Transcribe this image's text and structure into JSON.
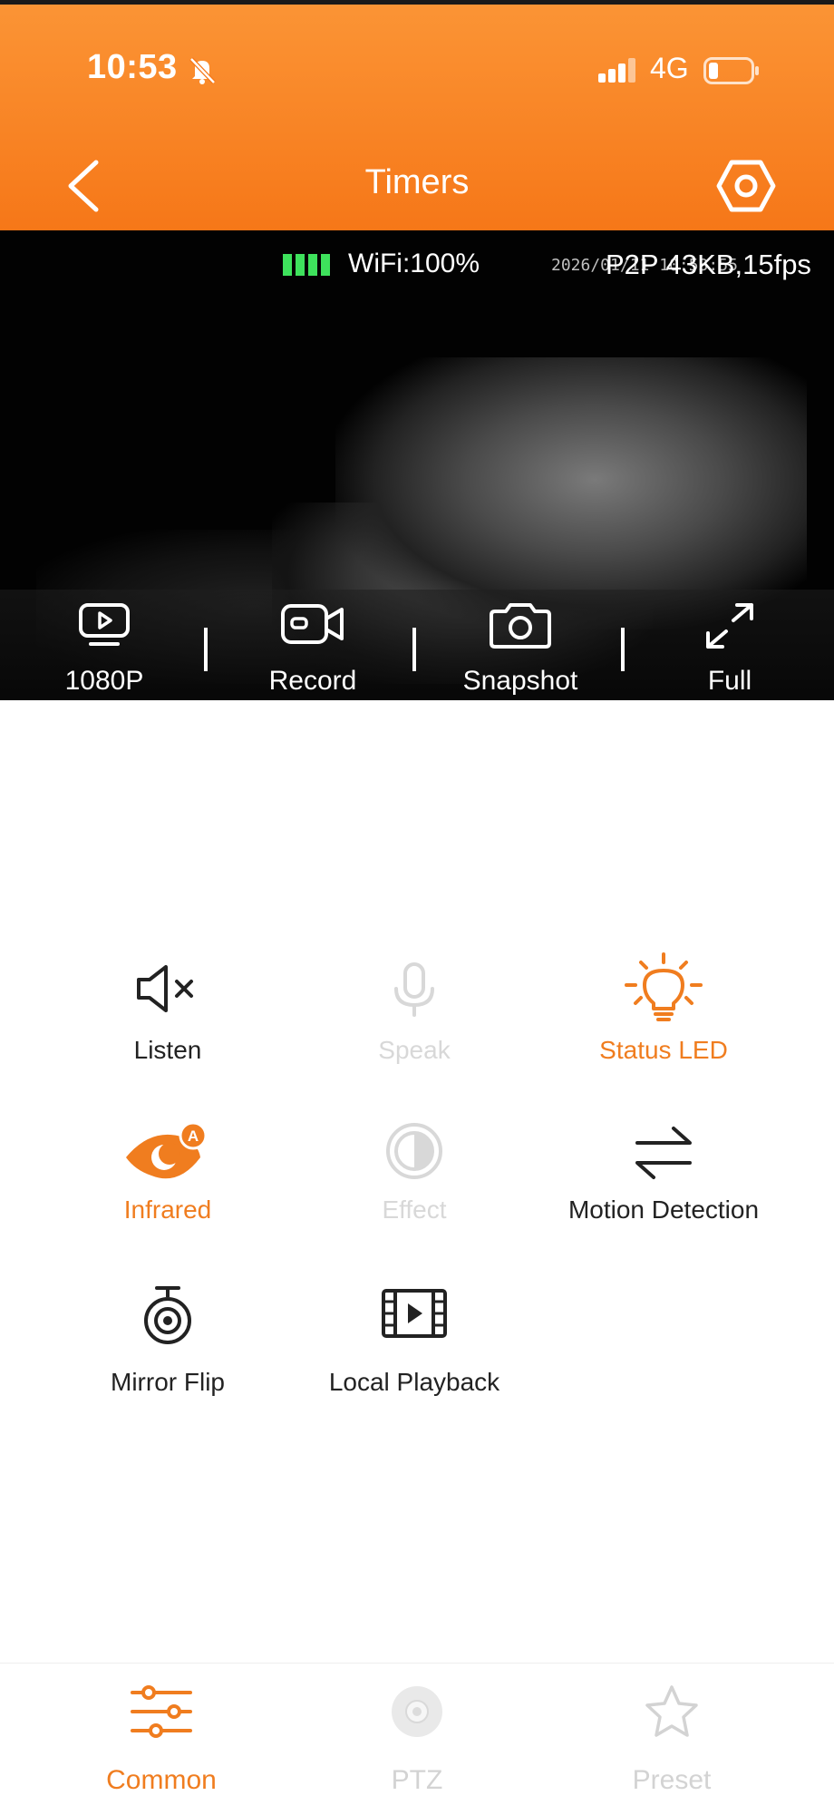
{
  "status_bar": {
    "time": "10:53",
    "network": "4G"
  },
  "header": {
    "title": "Timers"
  },
  "video": {
    "wifi_label": "WiFi:100%",
    "wifi_level": 1.0,
    "timestamp": "2026/01/11 10:53:55",
    "stream_info": "P2P 43KB,15fps",
    "toolbar": [
      {
        "label": "1080P",
        "icon": "video-quality-icon"
      },
      {
        "label": "Record",
        "icon": "video-camera-icon"
      },
      {
        "label": "Snapshot",
        "icon": "camera-icon"
      },
      {
        "label": "Full",
        "icon": "expand-icon"
      }
    ]
  },
  "controls": [
    {
      "label": "Listen",
      "icon": "speaker-muted-icon",
      "state": "normal"
    },
    {
      "label": "Speak",
      "icon": "microphone-icon",
      "state": "disabled"
    },
    {
      "label": "Status LED",
      "icon": "lightbulb-icon",
      "state": "active"
    },
    {
      "label": "Infrared",
      "icon": "infrared-eye-icon",
      "state": "active"
    },
    {
      "label": "Effect",
      "icon": "contrast-icon",
      "state": "disabled"
    },
    {
      "label": "Motion Detection",
      "icon": "swap-arrows-icon",
      "state": "normal"
    },
    {
      "label": "Mirror Flip",
      "icon": "webcam-icon",
      "state": "normal"
    },
    {
      "label": "Local Playback",
      "icon": "film-play-icon",
      "state": "normal"
    }
  ],
  "bottom_nav": [
    {
      "label": "Common",
      "icon": "sliders-icon",
      "state": "active"
    },
    {
      "label": "PTZ",
      "icon": "joystick-icon",
      "state": "inactive"
    },
    {
      "label": "Preset",
      "icon": "star-icon",
      "state": "inactive"
    }
  ],
  "colors": {
    "accent": "#f07d1f",
    "header_top": "#fb9435",
    "header_bottom": "#f67718",
    "wifi_green": "#3ee25c"
  }
}
